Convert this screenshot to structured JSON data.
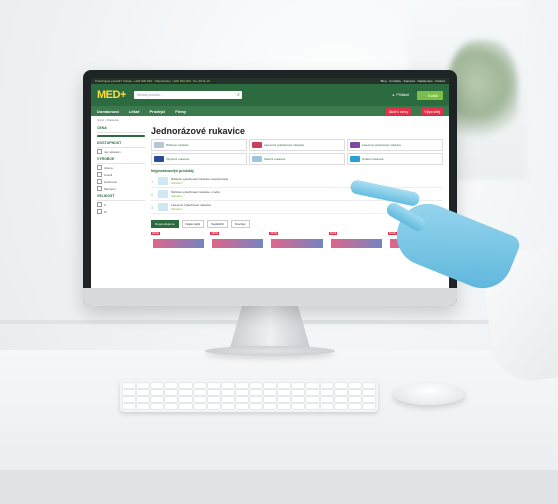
{
  "site": {
    "logo": "MED+",
    "top_left": "Potřebujete poradit? Volejte: +420 000 000 · Objednávky: +420 000 000 · Po–Pá 8–16",
    "top_right": "Blog · Kontakty · Doprava · Reklamace · Kariéra",
    "search_placeholder": "Hledat produkt...",
    "account_label": "Přihlásit",
    "cart_label": "Košík",
    "nav": [
      "Domácnost",
      "Lékař",
      "Prodejci",
      "Firmy"
    ],
    "nav_pill_1": "Akční ceny",
    "nav_pill_2": "Výprodej",
    "breadcrumb": "Úvod › Rukavice"
  },
  "page": {
    "title": "Jednorázové rukavice",
    "categories": [
      {
        "label": "Nitrilové rukavice",
        "color": "#b8c7d6"
      },
      {
        "label": "Latexové vyšetřovací rukavice",
        "color": "#c9405f"
      },
      {
        "label": "Latexové pudrované rukavice",
        "color": "#7a4aa0"
      },
      {
        "label": "Vinylové rukavice",
        "color": "#2a4a9c"
      },
      {
        "label": "Sterilní rukavice",
        "color": "#9fc6e0"
      },
      {
        "label": "Ostatní rukavice",
        "color": "#2a9fd6"
      }
    ],
    "bestsellers_title": "Nejprodávanější produkty",
    "products": [
      {
        "n": "1",
        "title": "Nitrilové vyšetřovací rukavice nepudrované",
        "stock": "Skladem"
      },
      {
        "n": "2",
        "title": "Nitrilové vyšetřovací rukavice, modré",
        "stock": "Skladem"
      },
      {
        "n": "3",
        "title": "Latexové vyšetřovací rukavice",
        "stock": "Skladem"
      }
    ],
    "tabs": [
      "Doporučujeme",
      "Nejlevnější",
      "Nejdražší",
      "Novinky"
    ],
    "cards_badge": "AKCE"
  },
  "sidebar": {
    "price_title": "CENA",
    "availability_title": "DOSTUPNOST",
    "availability_opt": "Jen skladem",
    "brand_title": "VÝROBCE",
    "brand_opts": [
      "Abena",
      "Ansell",
      "Hartmann",
      "Mercator"
    ],
    "size_title": "VELIKOST",
    "size_opts": [
      "S",
      "M",
      "L",
      "XL"
    ]
  }
}
